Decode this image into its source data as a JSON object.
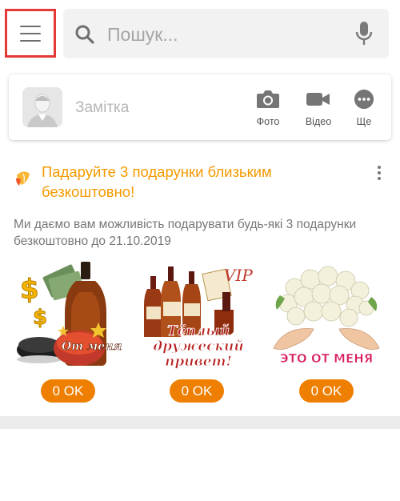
{
  "search": {
    "placeholder": "Пошук..."
  },
  "composer": {
    "note_label": "Замітка",
    "actions": [
      {
        "label": "Фото",
        "icon": "camera-icon"
      },
      {
        "label": "Відео",
        "icon": "video-icon"
      },
      {
        "label": "Ще",
        "icon": "more-icon"
      }
    ]
  },
  "promo": {
    "title": "Падаруйте 3 подарунки близьким безкоштовно!",
    "description": "Ми даємо вам можливість подарувати будь-які 3 подарунки безкоштовно до 21.10.2019",
    "gifts": [
      {
        "price": "0 OK",
        "caption": "От меня"
      },
      {
        "price": "0 OK",
        "caption": "Тёплый дружеский привет!",
        "badge": "VIP"
      },
      {
        "price": "0 OK",
        "caption": "ЭТО ОТ МЕНЯ"
      }
    ]
  },
  "colors": {
    "accent": "#ee7f00",
    "title": "#f59a00",
    "highlight": "#e53935"
  }
}
